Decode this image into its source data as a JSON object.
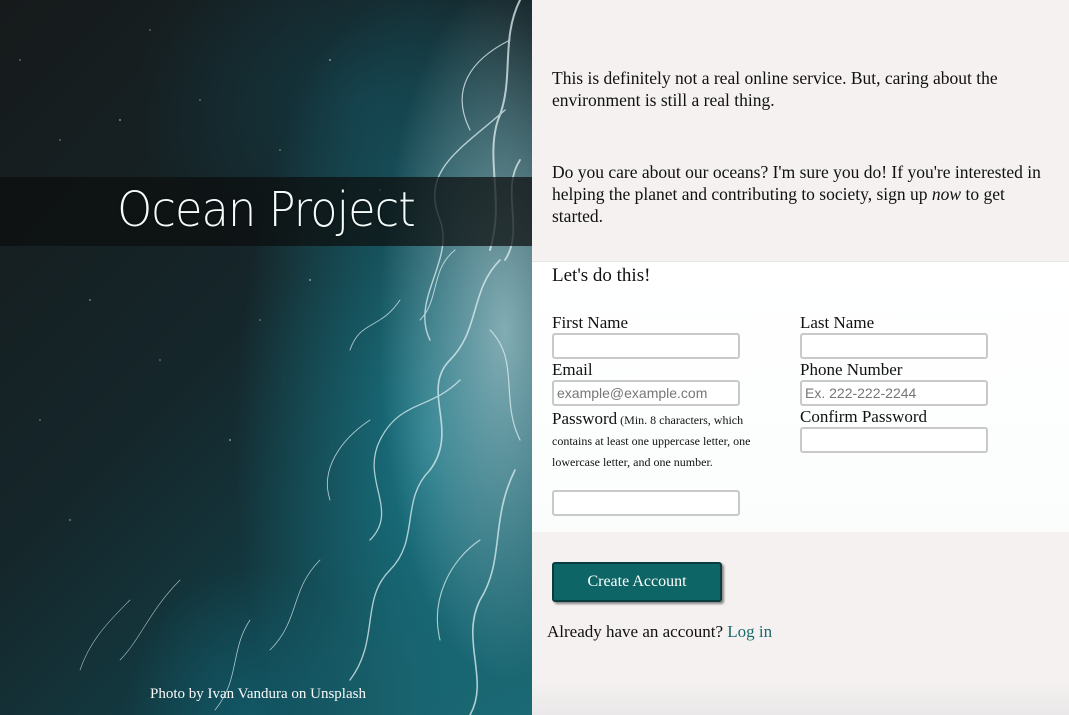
{
  "hero": {
    "title": "Ocean Project",
    "credit": "Photo by Ivan Vandura on Unsplash"
  },
  "intro": {
    "paragraph1": "This is definitely not a real online service. But, caring about the environment is still a real thing.",
    "paragraph2_before": "Do you care about our oceans? I'm sure you do! If you're interested in helping the planet and contributing to society, sign up ",
    "paragraph2_emph": "now",
    "paragraph2_after": " to get started."
  },
  "form": {
    "heading": "Let's do this!",
    "first_name_label": "First Name",
    "last_name_label": "Last Name",
    "email_label": "Email",
    "email_placeholder": "example@example.com",
    "phone_label": "Phone Number",
    "phone_placeholder": "Ex. 222-222-2244",
    "password_label": "Password",
    "password_note": "(Min. 8 characters, which contains at least one uppercase letter, one lowercase letter, and one number.",
    "confirm_password_label": "Confirm Password",
    "first_name_value": "",
    "last_name_value": "",
    "email_value": "",
    "phone_value": "",
    "password_value": "",
    "confirm_password_value": ""
  },
  "actions": {
    "create_account_label": "Create Account",
    "login_prompt": "Already have an account?",
    "login_link": "Log in"
  },
  "colors": {
    "accent": "#0d6565",
    "link": "#1a6b6e"
  }
}
